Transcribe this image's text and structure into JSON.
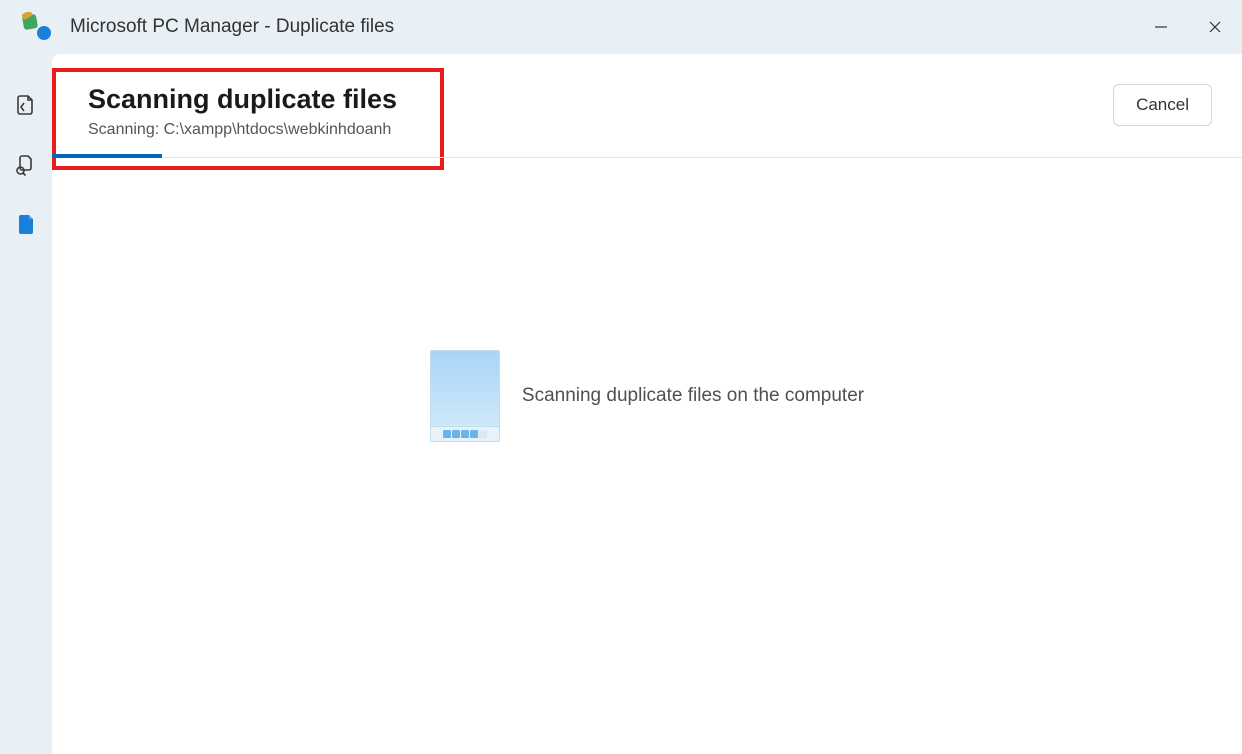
{
  "window": {
    "title": "Microsoft PC Manager - Duplicate files"
  },
  "header": {
    "title": "Scanning duplicate files",
    "subtitle": "Scanning: C:\\xampp\\htdocs\\webkinhdoanh",
    "cancel_label": "Cancel"
  },
  "body": {
    "status_text": "Scanning duplicate files on the computer"
  },
  "colors": {
    "accent": "#0067c0",
    "highlight_border": "#e81c1c",
    "background_light": "#e8f0f6"
  }
}
